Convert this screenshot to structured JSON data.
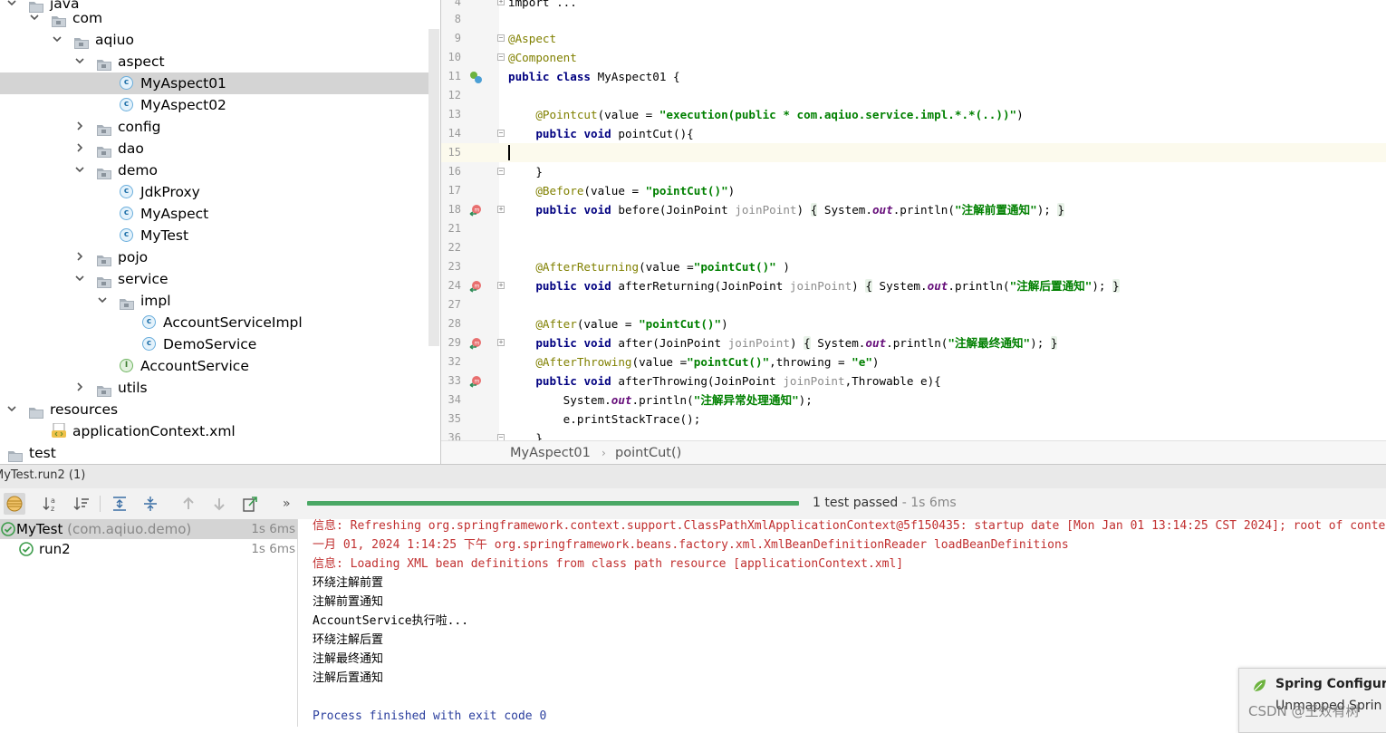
{
  "project_tree": {
    "items": [
      {
        "label": "java",
        "kind": "folder"
      },
      {
        "label": "com",
        "kind": "package"
      },
      {
        "label": "aqiuo",
        "kind": "package"
      },
      {
        "label": "aspect",
        "kind": "package"
      },
      {
        "label": "MyAspect01",
        "kind": "class",
        "selected": true
      },
      {
        "label": "MyAspect02",
        "kind": "class"
      },
      {
        "label": "config",
        "kind": "package"
      },
      {
        "label": "dao",
        "kind": "package"
      },
      {
        "label": "demo",
        "kind": "package"
      },
      {
        "label": "JdkProxy",
        "kind": "class"
      },
      {
        "label": "MyAspect",
        "kind": "class"
      },
      {
        "label": "MyTest",
        "kind": "test-class"
      },
      {
        "label": "pojo",
        "kind": "package"
      },
      {
        "label": "service",
        "kind": "package"
      },
      {
        "label": "impl",
        "kind": "package"
      },
      {
        "label": "AccountServiceImpl",
        "kind": "class"
      },
      {
        "label": "DemoService",
        "kind": "class"
      },
      {
        "label": "AccountService",
        "kind": "interface"
      },
      {
        "label": "utils",
        "kind": "package"
      },
      {
        "label": "resources",
        "kind": "folder"
      },
      {
        "label": "applicationContext.xml",
        "kind": "xml"
      },
      {
        "label": "test",
        "kind": "folder"
      }
    ]
  },
  "editor": {
    "lines": [
      {
        "n": "4",
        "code": "import ..."
      },
      {
        "n": "8",
        "code": ""
      },
      {
        "n": "9",
        "code": "@Aspect"
      },
      {
        "n": "10",
        "code": "@Component"
      },
      {
        "n": "11",
        "code": "public class MyAspect01 {"
      },
      {
        "n": "12",
        "code": ""
      },
      {
        "n": "13",
        "code": "    @Pointcut(value = \"execution(public * com.aqiuo.service.impl.*.*(..))\")"
      },
      {
        "n": "14",
        "code": "    public void pointCut(){"
      },
      {
        "n": "15",
        "code": ""
      },
      {
        "n": "16",
        "code": "    }"
      },
      {
        "n": "17",
        "code": "    @Before(value = \"pointCut()\")"
      },
      {
        "n": "18",
        "code": "    public void before(JoinPoint joinPoint) { System.out.println(\"注解前置通知\"); }"
      },
      {
        "n": "21",
        "code": ""
      },
      {
        "n": "22",
        "code": ""
      },
      {
        "n": "23",
        "code": "    @AfterReturning(value =\"pointCut()\" )"
      },
      {
        "n": "24",
        "code": "    public void afterReturning(JoinPoint joinPoint) { System.out.println(\"注解后置通知\"); }"
      },
      {
        "n": "27",
        "code": ""
      },
      {
        "n": "28",
        "code": "    @After(value = \"pointCut()\")"
      },
      {
        "n": "29",
        "code": "    public void after(JoinPoint joinPoint) { System.out.println(\"注解最终通知\"); }"
      },
      {
        "n": "32",
        "code": "    @AfterThrowing(value =\"pointCut()\",throwing = \"e\")"
      },
      {
        "n": "33",
        "code": "    public void afterThrowing(JoinPoint joinPoint,Throwable e){"
      },
      {
        "n": "34",
        "code": "        System.out.println(\"注解异常处理通知\");"
      },
      {
        "n": "35",
        "code": "        e.printStackTrace();"
      },
      {
        "n": "36",
        "code": "    }"
      }
    ],
    "breadcrumb": [
      "MyAspect01",
      "pointCut()"
    ]
  },
  "run": {
    "tab_title": "MyTest.run2 (1)",
    "status": "1 test passed",
    "duration": " - 1s 6ms",
    "progress": 1.0,
    "tests": [
      {
        "name": "MyTest",
        "suffix": " (com.aqiuo.demo)",
        "duration": "1s 6ms"
      },
      {
        "name": "run2",
        "suffix": "",
        "duration": "1s 6ms"
      }
    ],
    "console": [
      {
        "text": "信息: Refreshing org.springframework.context.support.ClassPathXmlApplicationContext@5f150435: startup date [Mon Jan 01 13:14:25 CST 2024]; root of context hierarchy",
        "style": "red"
      },
      {
        "text": "一月 01, 2024 1:14:25 下午 org.springframework.beans.factory.xml.XmlBeanDefinitionReader loadBeanDefinitions",
        "style": "red"
      },
      {
        "text": "信息: Loading XML bean definitions from class path resource [applicationContext.xml]",
        "style": "red"
      },
      {
        "text": "环绕注解前置",
        "style": "normal"
      },
      {
        "text": "注解前置通知",
        "style": "normal"
      },
      {
        "text": "AccountService执行啦...",
        "style": "normal"
      },
      {
        "text": "环绕注解后置",
        "style": "normal"
      },
      {
        "text": "注解最终通知",
        "style": "normal"
      },
      {
        "text": "注解后置通知",
        "style": "normal"
      },
      {
        "text": "",
        "style": "normal"
      },
      {
        "text": "Process finished with exit code 0",
        "style": "blue"
      }
    ]
  },
  "notification": {
    "title": "Spring Configura",
    "subtitle": "Unmapped Sprin"
  },
  "watermark": "CSDN @王效有树"
}
